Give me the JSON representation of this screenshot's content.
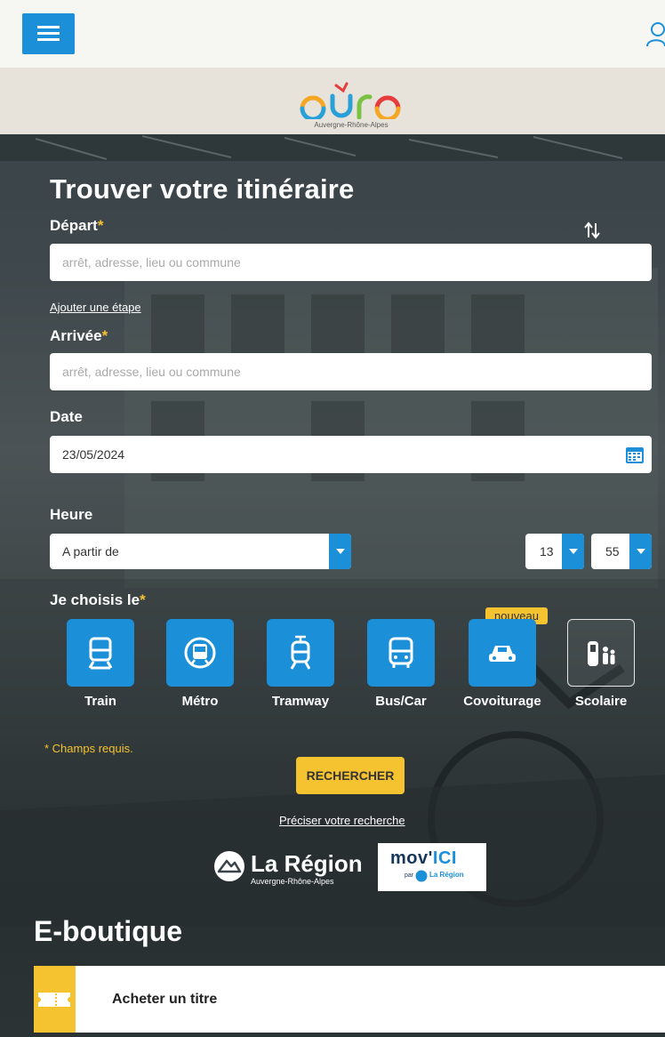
{
  "header": {
    "menu_icon": "hamburger-icon",
    "user_icon": "user-icon",
    "logo_text": "oùra",
    "logo_subtitle": "Auvergne-Rhône-Alpes"
  },
  "form": {
    "title": "Trouver votre itinéraire",
    "departure_label": "Départ",
    "arrival_label": "Arrivée",
    "required_mark": "*",
    "departure_placeholder": "arrêt, adresse, lieu ou commune",
    "arrival_placeholder": "arrêt, adresse, lieu ou commune",
    "add_step_link": "Ajouter une étape",
    "date_label": "Date",
    "date_value": "23/05/2024",
    "time_label": "Heure",
    "time_mode": "A partir de",
    "hour": "13",
    "minute": "55",
    "modes_label": "Je choisis le",
    "modes": [
      {
        "label": "Train",
        "icon": "train-icon"
      },
      {
        "label": "Métro",
        "icon": "metro-icon"
      },
      {
        "label": "Tramway",
        "icon": "tramway-icon"
      },
      {
        "label": "Bus/Car",
        "icon": "bus-icon"
      },
      {
        "label": "Covoiturage",
        "icon": "car-icon",
        "badge": "nouveau"
      },
      {
        "label": "Scolaire",
        "icon": "school-icon"
      }
    ],
    "required_note": "* Champs requis.",
    "search_button": "RECHERCHER",
    "refine_link": "Préciser votre recherche"
  },
  "partners": {
    "region_name": "La Région",
    "region_sub": "Auvergne-Rhône-Alpes",
    "movici_mov": "mov'",
    "movici_ici": "ICI",
    "movici_par": "par",
    "movici_region": "La Région"
  },
  "eboutique": {
    "title": "E-boutique",
    "item_label": "Acheter un titre",
    "item_icon": "ticket-icon"
  },
  "colors": {
    "accent_blue": "#1b8fd8",
    "accent_yellow": "#f5c230",
    "brand_band": "#e8e3da"
  }
}
